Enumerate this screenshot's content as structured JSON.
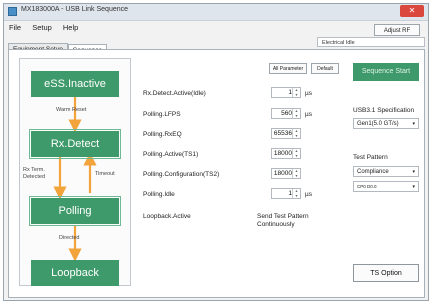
{
  "window": {
    "title": "MX183000A - USB Link Sequence",
    "close_label": "✕"
  },
  "menu": {
    "items": [
      "File",
      "Setup",
      "Help"
    ],
    "adjust_rf": "Adjust RF"
  },
  "tabs": [
    "Equipment Setup",
    "Sequence"
  ],
  "state_field": "Electrical Idle",
  "diagram": {
    "states": [
      "eSS.Inactive",
      "Rx.Detect",
      "Polling",
      "Loopback"
    ],
    "transitions": {
      "warm_reset": "Warm Reset",
      "rx_term": "Rx Term.",
      "detected": "Detected",
      "timeout": "Timeout",
      "directed": "Directed"
    }
  },
  "buttons": {
    "all_parameter": "All Parameter",
    "default": "Default",
    "sequence_start": "Sequence Start",
    "ts_option": "TS Option"
  },
  "params": [
    {
      "label": "Rx.Detect.Active(Idle)",
      "value": "1",
      "unit": "µs"
    },
    {
      "label": "Polling.LFPS",
      "value": "560",
      "unit": "µs"
    },
    {
      "label": "Polling.RxEQ",
      "value": "65536",
      "unit": ""
    },
    {
      "label": "Polling.Active(TS1)",
      "value": "18000",
      "unit": ""
    },
    {
      "label": "Polling.Configuration(TS2)",
      "value": "18000",
      "unit": ""
    },
    {
      "label": "Polling.Idle",
      "value": "1",
      "unit": "µs"
    }
  ],
  "loopback": {
    "label": "Loopback.Active",
    "text_line1": "Send Test Pattern",
    "text_line2": "Continuously"
  },
  "right": {
    "spec_label": "USB3.1 Specification",
    "spec_value": "Gen1(5.0 GT/s)",
    "pattern_label": "Test Pattern",
    "pattern_value": "Compliance",
    "pattern_sub_value": "CP0 D0.0"
  },
  "icons": {
    "caret": "▾",
    "spin_up": "▲",
    "spin_down": "▼"
  },
  "colors": {
    "state_green": "#3f9a6b",
    "arrow_orange": "#f2a33a"
  }
}
